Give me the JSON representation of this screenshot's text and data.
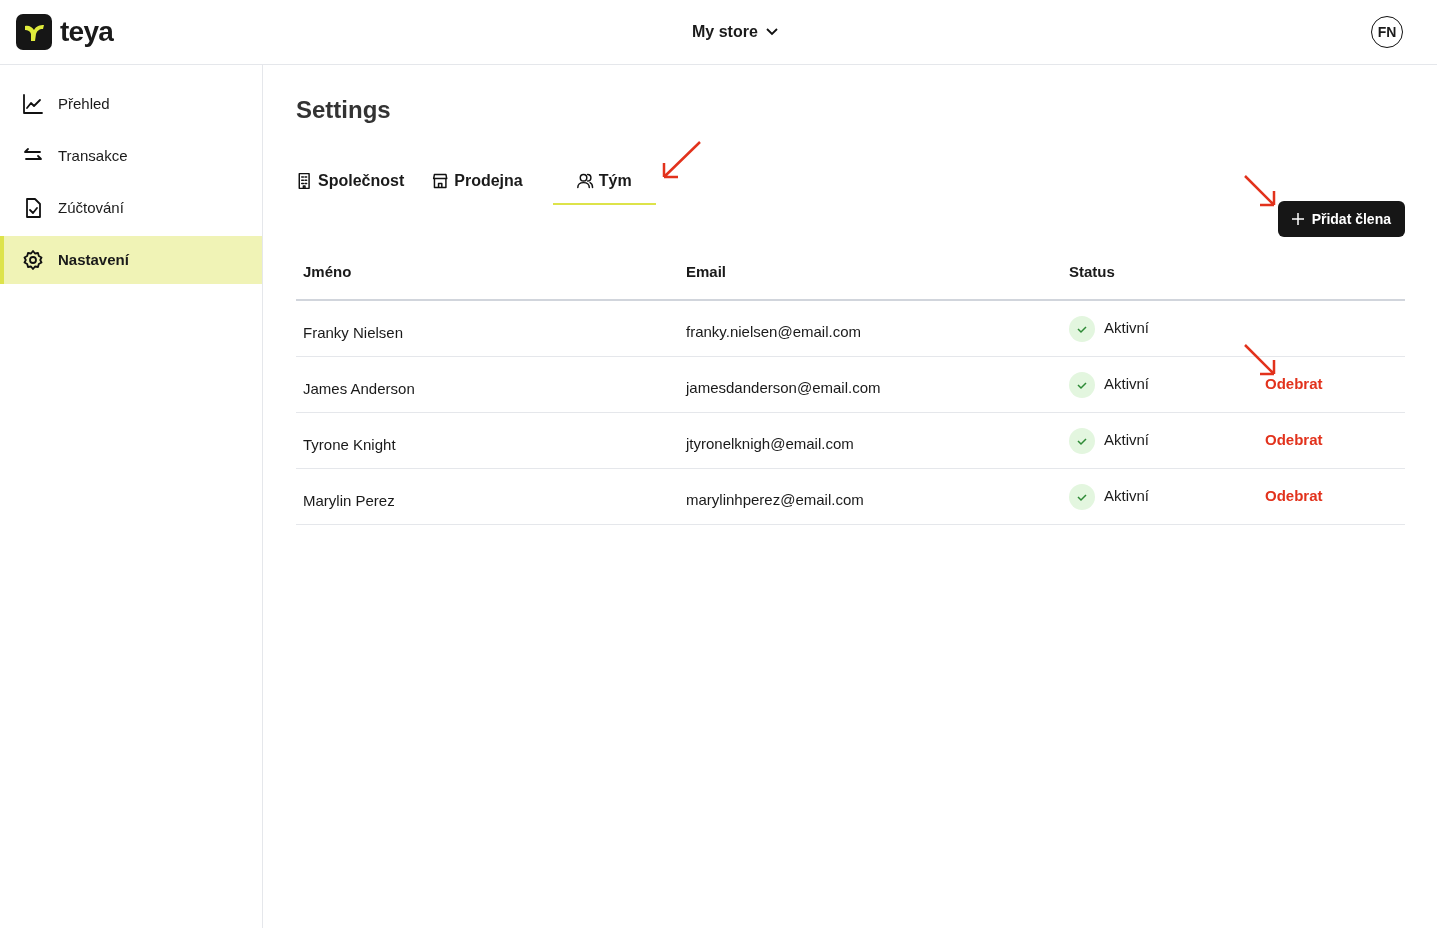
{
  "header": {
    "logo_text": "teya",
    "store": "My store",
    "avatar": "FN"
  },
  "sidebar": {
    "items": [
      {
        "label": "Přehled",
        "selected": false
      },
      {
        "label": "Transakce",
        "selected": false
      },
      {
        "label": "Zúčtování",
        "selected": false
      },
      {
        "label": "Nastavení",
        "selected": true
      }
    ]
  },
  "page": {
    "title": "Settings",
    "tabs": [
      {
        "label": "Společnost",
        "selected": false
      },
      {
        "label": "Prodejna",
        "selected": false
      },
      {
        "label": "Tým",
        "selected": true
      }
    ],
    "add_button": "Přidat člena",
    "table": {
      "columns": [
        "Jméno",
        "Email",
        "Status"
      ],
      "rows": [
        {
          "name": "Franky Nielsen",
          "email": "franky.nielsen@email.com",
          "status": "Aktivní"
        },
        {
          "name": "James Anderson",
          "email": "jamesdanderson@email.com",
          "status": "Aktivní",
          "action": "Odebrat"
        },
        {
          "name": "Tyrone Knight",
          "email": "jtyronelknigh@email.com",
          "status": "Aktivní",
          "action": "Odebrat"
        },
        {
          "name": "Marylin Perez",
          "email": "marylinhperez@email.com",
          "status": "Aktivní",
          "action": "Odebrat"
        }
      ]
    }
  }
}
